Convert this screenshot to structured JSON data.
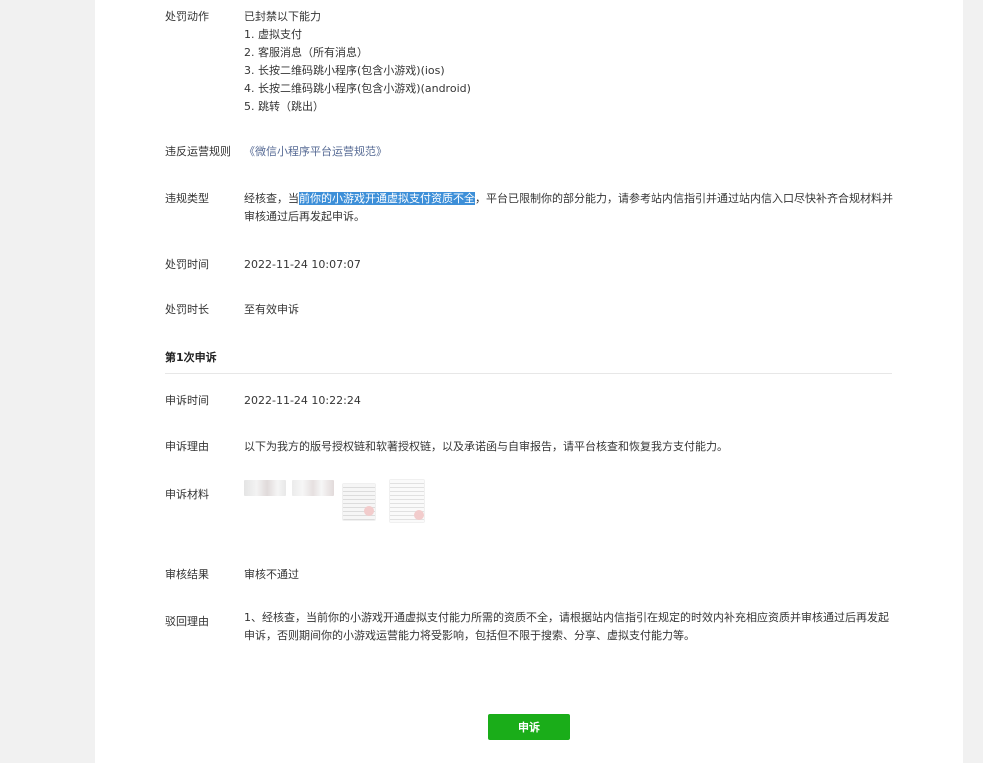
{
  "penalty_action": {
    "label": "处罚动作",
    "intro": "已封禁以下能力",
    "items": [
      "1. 虚拟支付",
      "2. 客服消息（所有消息）",
      "3. 长按二维码跳小程序(包含小游戏)(ios)",
      "4. 长按二维码跳小程序(包含小游戏)(android)",
      "5. 跳转（跳出）"
    ]
  },
  "violated_rule": {
    "label": "违反运营规则",
    "link_text": "《微信小程序平台运营规范》"
  },
  "violation_type": {
    "label": "违规类型",
    "prefix": "经核查，当",
    "highlight": "前你的小游戏开通虚拟支付资质不全",
    "suffix": "，平台已限制你的部分能力，请参考站内信指引并通过站内信入口尽快补齐合规材料并审核通过后再发起申诉。"
  },
  "penalty_time": {
    "label": "处罚时间",
    "value": "2022-11-24 10:07:07"
  },
  "penalty_duration": {
    "label": "处罚时长",
    "value": "至有效申诉"
  },
  "appeal": {
    "title": "第1次申诉",
    "time_label": "申诉时间",
    "time_value": "2022-11-24 10:22:24",
    "reason_label": "申诉理由",
    "reason_value": "以下为我方的版号授权链和软著授权链，以及承诺函与自审报告，请平台核查和恢复我方支付能力。",
    "materials_label": "申诉材料",
    "result_label": "审核结果",
    "result_value": "审核不通过",
    "reject_label": "驳回理由",
    "reject_value": "1、经核查，当前你的小游戏开通虚拟支付能力所需的资质不全，请根据站内信指引在规定的时效内补充相应资质并审核通过后再发起申诉，否则期间你的小游戏运营能力将受影响，包括但不限于搜索、分享、虚拟支付能力等。"
  },
  "appeal_button": {
    "label": "申诉"
  },
  "colors": {
    "accent_green": "#1aad19",
    "link_blue": "#576b95",
    "highlight_blue": "#3d8fd8"
  }
}
